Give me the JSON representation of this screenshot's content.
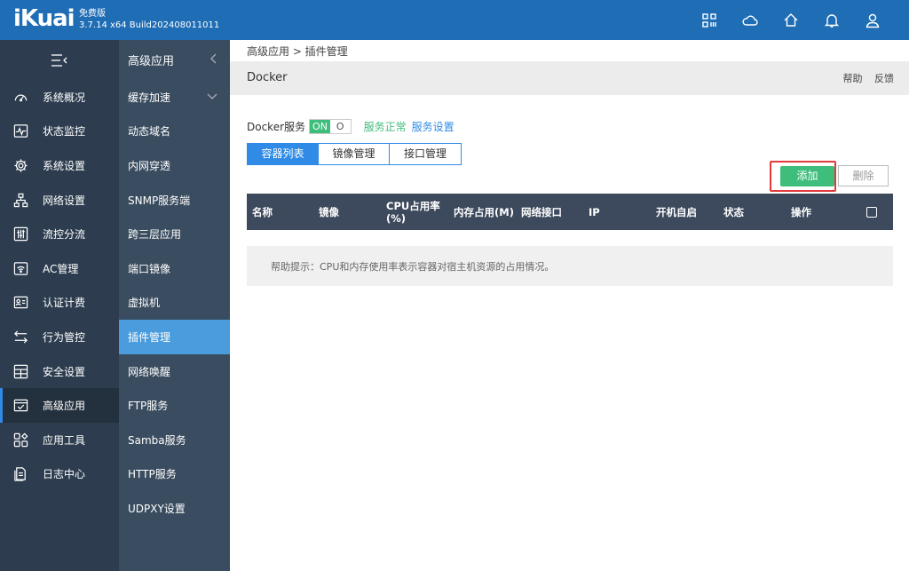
{
  "brand": {
    "logo": "iKuai",
    "edition": "免费版",
    "version": "3.7.14 x64 Build202408011011"
  },
  "top_icons": [
    "apps-icon",
    "cloud-icon",
    "home-icon",
    "bell-icon",
    "user-icon"
  ],
  "main_nav": [
    {
      "label": "系统概况",
      "icon": "dashboard-icon"
    },
    {
      "label": "状态监控",
      "icon": "monitor-icon"
    },
    {
      "label": "系统设置",
      "icon": "gear-icon"
    },
    {
      "label": "网络设置",
      "icon": "network-icon"
    },
    {
      "label": "流控分流",
      "icon": "sliders-icon"
    },
    {
      "label": "AC管理",
      "icon": "wifi-icon"
    },
    {
      "label": "认证计费",
      "icon": "id-card-icon"
    },
    {
      "label": "行为管控",
      "icon": "arrows-icon"
    },
    {
      "label": "安全设置",
      "icon": "shield-grid-icon"
    },
    {
      "label": "高级应用",
      "icon": "checklist-icon",
      "active": true
    },
    {
      "label": "应用工具",
      "icon": "tools-icon"
    },
    {
      "label": "日志中心",
      "icon": "log-icon"
    }
  ],
  "sub_nav": {
    "header": "高级应用",
    "items": [
      {
        "label": "缓存加速",
        "has_chevron": true
      },
      {
        "label": "动态域名"
      },
      {
        "label": "内网穿透"
      },
      {
        "label": "SNMP服务端"
      },
      {
        "label": "跨三层应用"
      },
      {
        "label": "端口镜像"
      },
      {
        "label": "虚拟机"
      },
      {
        "label": "插件管理",
        "active": true
      },
      {
        "label": "网络唤醒"
      },
      {
        "label": "FTP服务"
      },
      {
        "label": "Samba服务"
      },
      {
        "label": "HTTP服务"
      },
      {
        "label": "UDPXY设置"
      }
    ]
  },
  "main": {
    "breadcrumb": "高级应用 > 插件管理",
    "title": "Docker",
    "help": "帮助",
    "feedback": "反馈",
    "service": {
      "label": "Docker服务",
      "toggle_on": "ON",
      "toggle_off": "O",
      "status": "服务正常",
      "settings": "服务设置"
    },
    "tabs": [
      "容器列表",
      "镜像管理",
      "接口管理"
    ],
    "add_button": "添加",
    "delete_button": "删除",
    "table_headers": {
      "name": "名称",
      "image": "镜像",
      "cpu_line1": "CPU占用率",
      "cpu_line2": "(%)",
      "memory": "内存占用(M)",
      "network": "网络接口",
      "ip": "IP",
      "autostart": "开机自启",
      "status": "状态",
      "actions": "操作"
    },
    "help_tip": "帮助提示：CPU和内存使用率表示容器对宿主机资源的占用情况。"
  },
  "colors": {
    "topbar": "#1f6db5",
    "accent": "#2f8be6",
    "green": "#3ebd7b",
    "highlight": "#e23a3a"
  }
}
